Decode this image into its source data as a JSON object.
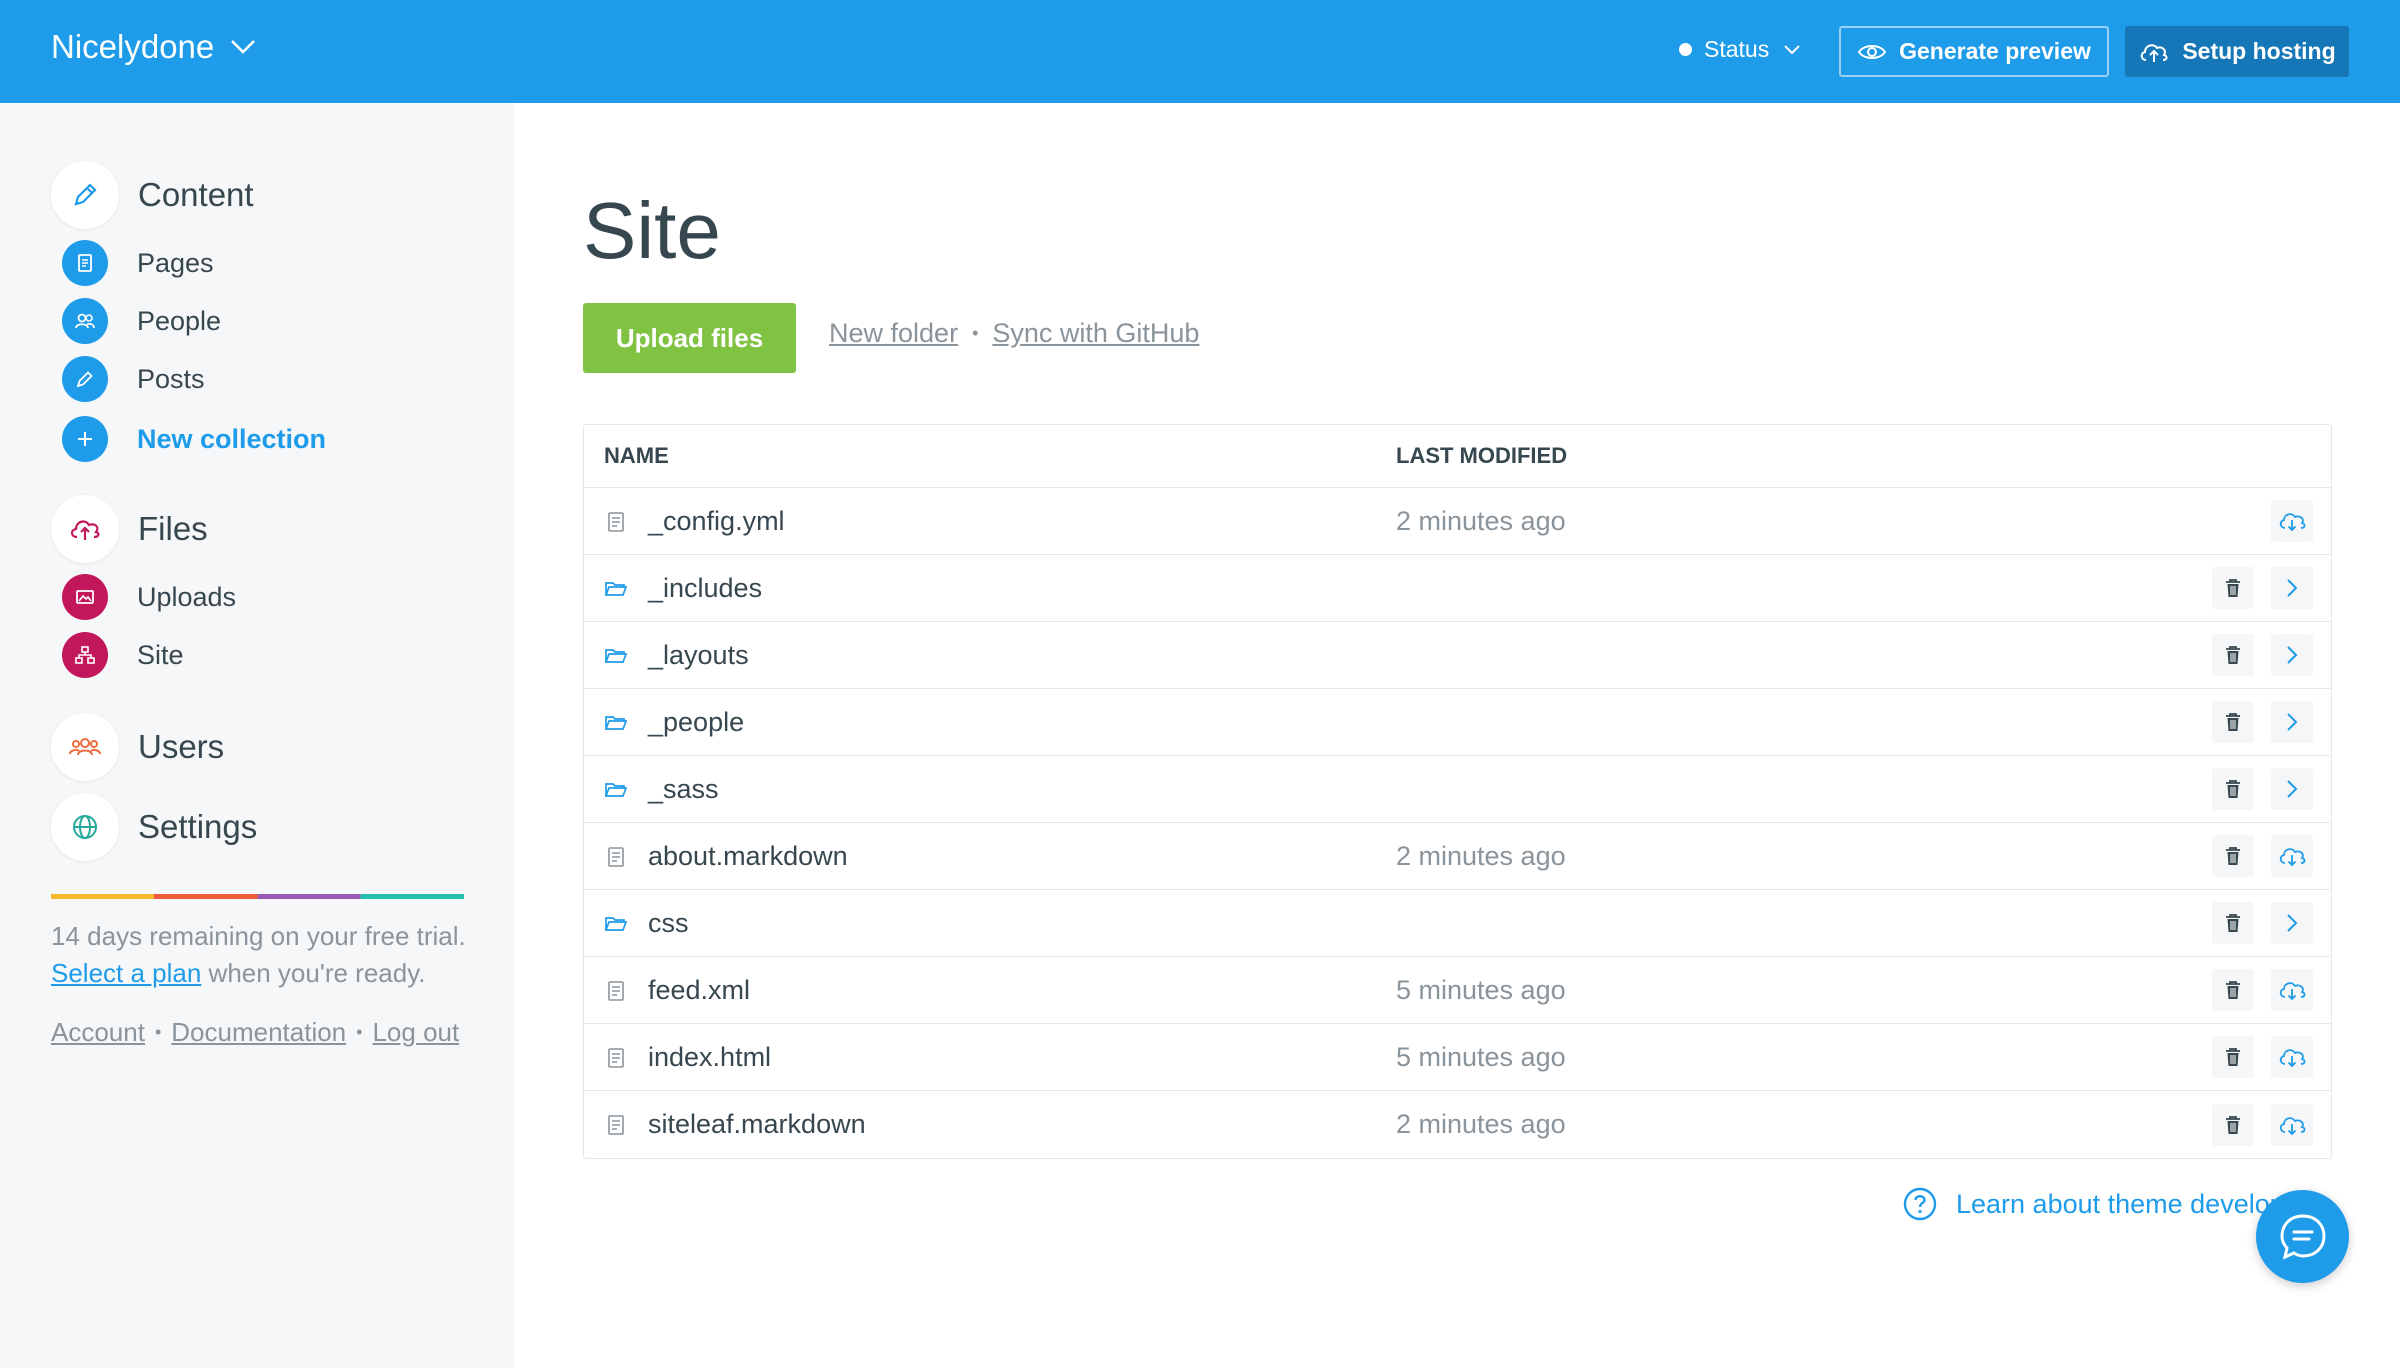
{
  "header": {
    "site_name": "Nicelydone",
    "status_label": "Status",
    "generate_preview": "Generate preview",
    "setup_hosting": "Setup hosting"
  },
  "sidebar": {
    "content_label": "Content",
    "collections": [
      {
        "label": "Pages",
        "icon": "document-icon"
      },
      {
        "label": "People",
        "icon": "people-icon"
      },
      {
        "label": "Posts",
        "icon": "pencil-icon"
      }
    ],
    "new_collection": "New collection",
    "files_label": "Files",
    "file_items": [
      {
        "label": "Uploads",
        "icon": "image-icon"
      },
      {
        "label": "Site",
        "icon": "sitemap-icon"
      }
    ],
    "users_label": "Users",
    "settings_label": "Settings",
    "trial_text": "14 days remaining on your free trial.",
    "select_plan": "Select a plan",
    "trial_suffix": " when you're ready.",
    "footer_links": [
      "Account",
      "Documentation",
      "Log out"
    ]
  },
  "main": {
    "title": "Site",
    "upload_button": "Upload files",
    "new_folder": "New folder",
    "sync_github": "Sync with GitHub",
    "columns": {
      "name": "NAME",
      "modified": "LAST MODIFIED"
    },
    "rows": [
      {
        "name": "_config.yml",
        "type": "file",
        "modified": "2 minutes ago",
        "delete": false,
        "action": "download"
      },
      {
        "name": "_includes",
        "type": "folder",
        "modified": "",
        "delete": true,
        "action": "open"
      },
      {
        "name": "_layouts",
        "type": "folder",
        "modified": "",
        "delete": true,
        "action": "open"
      },
      {
        "name": "_people",
        "type": "folder",
        "modified": "",
        "delete": true,
        "action": "open"
      },
      {
        "name": "_sass",
        "type": "folder",
        "modified": "",
        "delete": true,
        "action": "open"
      },
      {
        "name": "about.markdown",
        "type": "file",
        "modified": "2 minutes ago",
        "delete": true,
        "action": "download"
      },
      {
        "name": "css",
        "type": "folder",
        "modified": "",
        "delete": true,
        "action": "open"
      },
      {
        "name": "feed.xml",
        "type": "file",
        "modified": "5 minutes ago",
        "delete": true,
        "action": "download"
      },
      {
        "name": "index.html",
        "type": "file",
        "modified": "5 minutes ago",
        "delete": true,
        "action": "download"
      },
      {
        "name": "siteleaf.markdown",
        "type": "file",
        "modified": "2 minutes ago",
        "delete": true,
        "action": "download"
      }
    ],
    "learn_link": "Learn about theme develop"
  },
  "colors": {
    "header_blue": "#1e9be9",
    "hosting_blue": "#1577b8",
    "upload_green": "#80c342",
    "files_red": "#c2185b",
    "users_orange": "#ef6c3c",
    "settings_teal": "#25a99a"
  }
}
